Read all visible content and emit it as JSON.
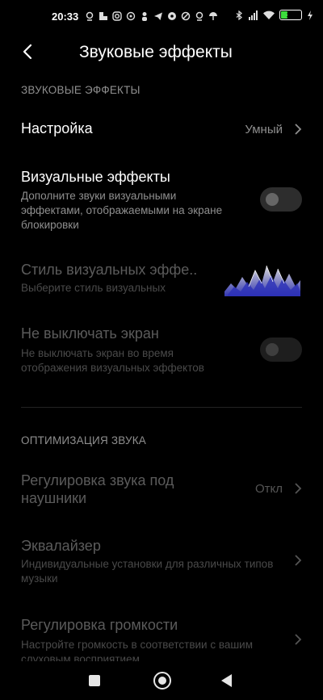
{
  "status": {
    "time": "20:33",
    "battery": "31",
    "icons": [
      "location-pin-icon",
      "screenshot-icon",
      "instagram-icon",
      "whatsapp-icon",
      "person-icon",
      "telegram-icon",
      "soccer-icon",
      "vpn-icon",
      "location-pin-icon",
      "umbrella-icon",
      "bluetooth-icon",
      "signal-icon",
      "wifi-icon",
      "battery-icon",
      "charging-icon"
    ]
  },
  "header": {
    "title": "Звуковые эффекты"
  },
  "sections": {
    "effects_title": "ЗВУКОВЫЕ ЭФФЕКТЫ",
    "optimization_title": "ОПТИМИЗАЦИЯ ЗВУКА"
  },
  "rows": {
    "setting": {
      "title": "Настройка",
      "value": "Умный"
    },
    "visual_effects": {
      "title": "Визуальные эффекты",
      "subtitle": "Дополните звуки визуальными эффектами, отображаемыми на экране блокировки",
      "enabled": false
    },
    "visual_style": {
      "title": "Стиль визуальных эффе..",
      "subtitle": "Выберите стиль визуальных"
    },
    "keep_screen_on": {
      "title": "Не выключать экран",
      "subtitle": "Не выключать экран во время отображения визуальных эффектов",
      "enabled": false
    },
    "headphones": {
      "title": "Регулировка звука под наушники",
      "value": "Откл"
    },
    "equalizer": {
      "title": "Эквалайзер",
      "subtitle": "Индивидуальные установки для различных типов музыки"
    },
    "volume": {
      "title": "Регулировка громкости",
      "subtitle": "Настройте громкость в соответствии с вашим слуховым восприятием"
    }
  },
  "colors": {
    "background": "#000000",
    "text_primary": "#ffffff",
    "text_secondary": "#8f8f8f",
    "text_disabled": "#5b5b5b",
    "battery": "#3ddc3d"
  }
}
